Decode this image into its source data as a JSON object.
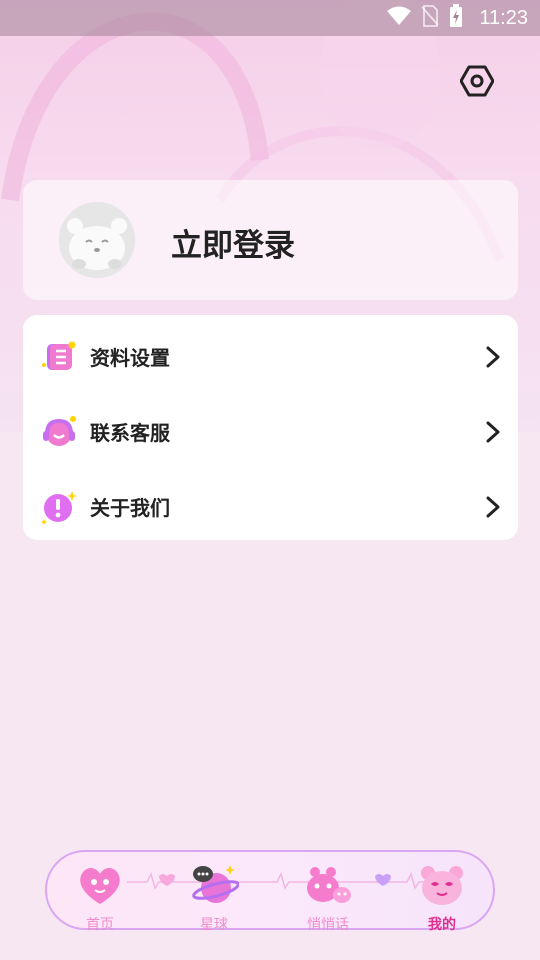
{
  "status_bar": {
    "time": "11:23",
    "icons": [
      "wifi-icon",
      "no-sim-icon",
      "battery-charging-icon"
    ]
  },
  "header": {
    "settings_icon": "hexagon-settings-icon"
  },
  "login": {
    "label": "立即登录",
    "avatar_icon": "default-avatar-icon"
  },
  "menu": {
    "items": [
      {
        "label": "资料设置",
        "icon": "profile-document-icon"
      },
      {
        "label": "联系客服",
        "icon": "headset-icon"
      },
      {
        "label": "关于我们",
        "icon": "info-exclamation-icon"
      }
    ]
  },
  "tabbar": {
    "tabs": [
      {
        "label": "首页",
        "icon": "heart-home-icon",
        "active": false
      },
      {
        "label": "星球",
        "icon": "planet-chat-icon",
        "active": false
      },
      {
        "label": "悄悄话",
        "icon": "whisper-faces-icon",
        "active": false
      },
      {
        "label": "我的",
        "icon": "bear-profile-icon",
        "active": true
      }
    ]
  },
  "colors": {
    "accent": "#e0308f",
    "tab_inactive": "#f08ccc",
    "tab_border": "#d9a6f3"
  }
}
